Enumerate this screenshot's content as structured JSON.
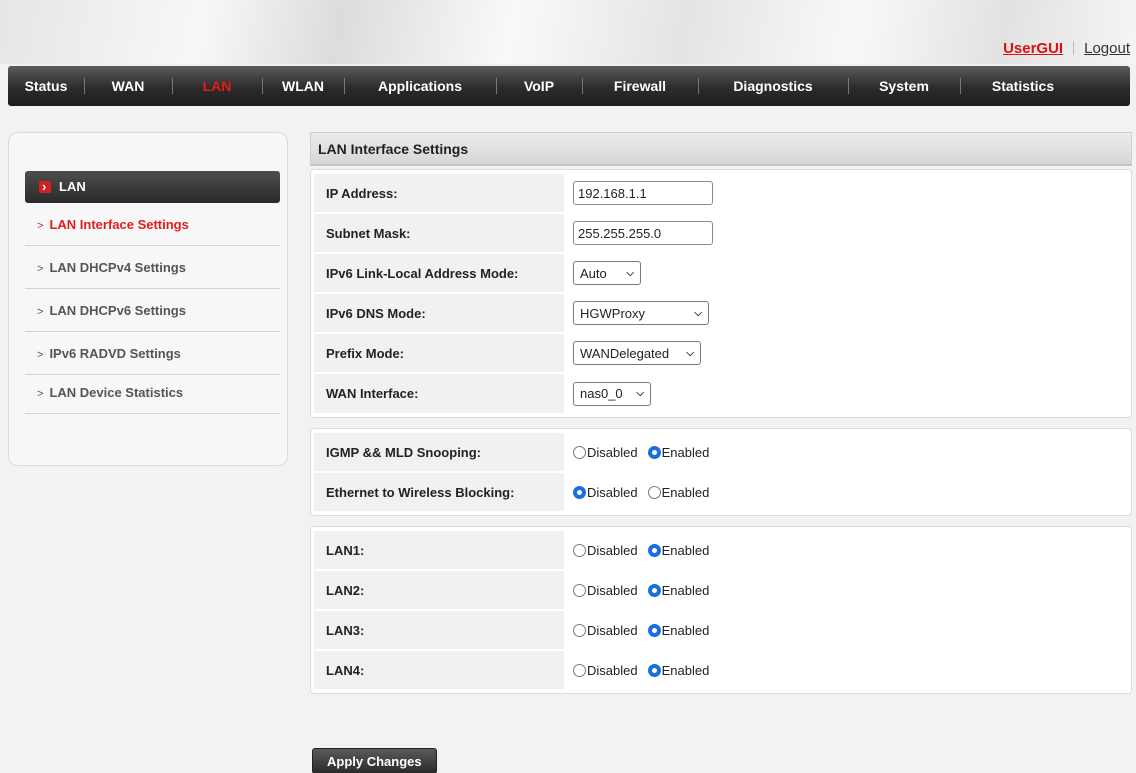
{
  "header": {
    "user_gui": "UserGUI",
    "logout": "Logout"
  },
  "nav": [
    {
      "label": "Status",
      "active": false
    },
    {
      "label": "WAN",
      "active": false
    },
    {
      "label": "LAN",
      "active": true
    },
    {
      "label": "WLAN",
      "active": false
    },
    {
      "label": "Applications",
      "active": false
    },
    {
      "label": "VoIP",
      "active": false
    },
    {
      "label": "Firewall",
      "active": false
    },
    {
      "label": "Diagnostics",
      "active": false
    },
    {
      "label": "System",
      "active": false
    },
    {
      "label": "Statistics",
      "active": false
    }
  ],
  "sidebar": {
    "title": "LAN",
    "items": [
      {
        "label": "LAN Interface Settings",
        "active": true
      },
      {
        "label": "LAN DHCPv4 Settings",
        "active": false
      },
      {
        "label": "LAN DHCPv6 Settings",
        "active": false
      },
      {
        "label": "IPv6 RADVD Settings",
        "active": false
      },
      {
        "label": "LAN Device Statistics",
        "active": false
      }
    ]
  },
  "main": {
    "section_title": "LAN Interface Settings",
    "fields": {
      "ip_label": "IP Address:",
      "ip_value": "192.168.1.1",
      "mask_label": "Subnet Mask:",
      "mask_value": "255.255.255.0",
      "ll_label": "IPv6 Link-Local Address Mode:",
      "ll_value": "Auto",
      "dns_label": "IPv6 DNS Mode:",
      "dns_value": "HGWProxy",
      "prefix_label": "Prefix Mode:",
      "prefix_value": "WANDelegated",
      "wan_label": "WAN Interface:",
      "wan_value": "nas0_0"
    },
    "options": {
      "igmp_label": "IGMP && MLD Snooping:",
      "igmp_value": "Enabled",
      "eth_label": "Ethernet to Wireless Blocking:",
      "eth_value": "Disabled"
    },
    "ports": [
      {
        "label": "LAN1:",
        "value": "Enabled"
      },
      {
        "label": "LAN2:",
        "value": "Enabled"
      },
      {
        "label": "LAN3:",
        "value": "Enabled"
      },
      {
        "label": "LAN4:",
        "value": "Enabled"
      }
    ],
    "radio_disabled": "Disabled",
    "radio_enabled": "Enabled",
    "apply_label": "Apply Changes"
  },
  "colors": {
    "accent_red": "#e51b1b",
    "radio_blue": "#1a6fe0"
  }
}
